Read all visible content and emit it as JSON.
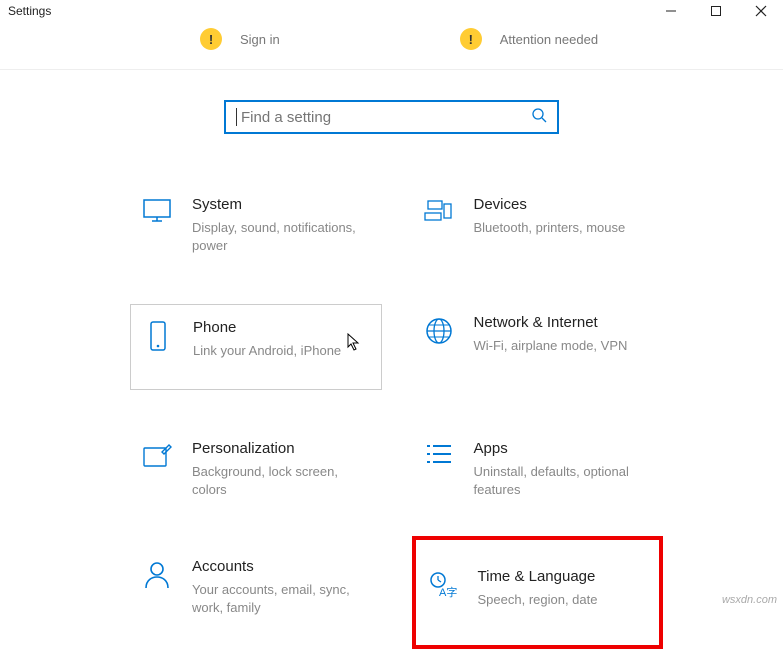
{
  "window": {
    "title": "Settings"
  },
  "status": {
    "signin": "Sign in",
    "attention": "Attention needed"
  },
  "search": {
    "placeholder": "Find a setting"
  },
  "tiles": {
    "system": {
      "title": "System",
      "desc": "Display, sound, notifications, power"
    },
    "devices": {
      "title": "Devices",
      "desc": "Bluetooth, printers, mouse"
    },
    "phone": {
      "title": "Phone",
      "desc": "Link your Android, iPhone"
    },
    "network": {
      "title": "Network & Internet",
      "desc": "Wi-Fi, airplane mode, VPN"
    },
    "personalization": {
      "title": "Personalization",
      "desc": "Background, lock screen, colors"
    },
    "apps": {
      "title": "Apps",
      "desc": "Uninstall, defaults, optional features"
    },
    "accounts": {
      "title": "Accounts",
      "desc": "Your accounts, email, sync, work, family"
    },
    "time": {
      "title": "Time & Language",
      "desc": "Speech, region, date"
    }
  },
  "footer": "wsxdn.com"
}
